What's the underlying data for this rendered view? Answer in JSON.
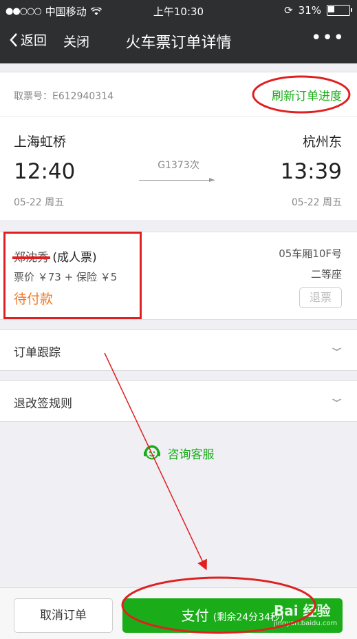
{
  "status_bar": {
    "carrier": "中国移动",
    "time": "上午10:30",
    "battery": "31%"
  },
  "nav": {
    "back_label": "返回",
    "close_label": "关闭",
    "title": "火车票订单详情",
    "more_label": "•••"
  },
  "ticket": {
    "pickup_label": "取票号：E612940314",
    "refresh_label": "刷新订单进度"
  },
  "route": {
    "from_station": "上海虹桥",
    "to_station": "杭州东",
    "train_no": "G1373次",
    "depart_time": "12:40",
    "arrive_time": "13:39",
    "depart_date": "05-22 周五",
    "arrive_date": "05-22 周五"
  },
  "passenger": {
    "name": "郑沈秀",
    "type": "(成人票)",
    "price": "票价 ￥73 + 保险 ￥5",
    "status": "待付款",
    "seat": "05车厢10F号",
    "class": "二等座",
    "refund_label": "退票"
  },
  "rows": {
    "tracking": "订单跟踪",
    "rules": "退改签规则"
  },
  "service_label": "咨询客服",
  "bottom": {
    "cancel_label": "取消订单",
    "pay_label": "支付",
    "pay_sub": "(剩余24分34秒)"
  },
  "watermark": {
    "brand": "Bai 经验",
    "url": "jingyan.baidu.com"
  },
  "colors": {
    "accent_green": "#1aad19",
    "pending_orange": "#f07b28",
    "annotation_red": "#e02020"
  }
}
